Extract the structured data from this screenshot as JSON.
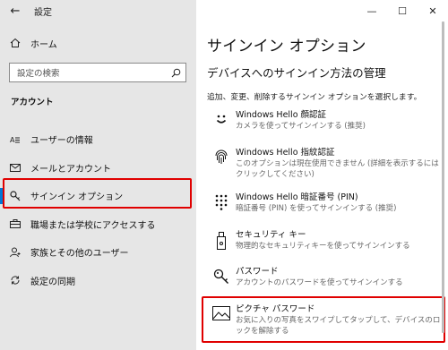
{
  "window": {
    "title": "設定"
  },
  "nav": {
    "back_icon": "back-arrow-icon",
    "home_label": "ホーム",
    "search_placeholder": "設定の検索",
    "section_label": "アカウント",
    "items": [
      {
        "label": "ユーザーの情報",
        "icon": "user-info-icon"
      },
      {
        "label": "メールとアカウント",
        "icon": "mail-icon"
      },
      {
        "label": "サインイン オプション",
        "icon": "key-icon",
        "selected": true
      },
      {
        "label": "職場または学校にアクセスする",
        "icon": "briefcase-icon"
      },
      {
        "label": "家族とその他のユーザー",
        "icon": "people-icon"
      },
      {
        "label": "設定の同期",
        "icon": "sync-icon"
      }
    ]
  },
  "controls": {
    "minimize": "—",
    "maximize": "☐",
    "close": "✕"
  },
  "main": {
    "title": "サインイン オプション",
    "subtitle": "デバイスへのサインイン方法の管理",
    "description": "追加、変更、削除するサインイン オプションを選択します。",
    "options": [
      {
        "title": "Windows Hello 顔認証",
        "sub": "カメラを使ってサインインする (推奨)",
        "icon": "face-icon"
      },
      {
        "title": "Windows Hello 指紋認証",
        "sub": "このオプションは現在使用できません (詳細を表示するにはクリックしてください)",
        "icon": "fingerprint-icon"
      },
      {
        "title": "Windows Hello 暗証番号 (PIN)",
        "sub": "暗証番号 (PIN) を使ってサインインする (推奨)",
        "icon": "pin-icon"
      },
      {
        "title": "セキュリティ キー",
        "sub": "物理的なセキュリティキーを使ってサインインする",
        "icon": "usb-key-icon"
      },
      {
        "title": "パスワード",
        "sub": "アカウントのパスワードを使ってサインインする",
        "icon": "key-icon"
      },
      {
        "title": "ピクチャ パスワード",
        "sub": "お気に入りの写真をスワイプしてタップして、デバイスのロックを解除する",
        "icon": "picture-icon"
      }
    ]
  }
}
